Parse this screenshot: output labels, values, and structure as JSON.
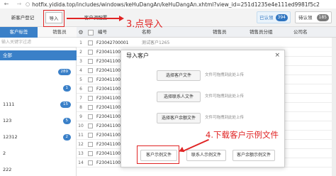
{
  "browser": {
    "back_icon": "arrow-left",
    "forward_icon": "arrow-right",
    "url": "hotfix.yididа.top/includes/windows/keHuDangAn/keHuDangAn.xhtml?view_id=251d1235e4e111ed9981f5c2"
  },
  "toolbar": {
    "new_customer_label": "新客户登记",
    "import_label": "导入",
    "import_config_label": "客户调配置",
    "filtered_label": "已认领",
    "filtered_count": "394",
    "todo_label": "待认领",
    "todo_count": "185"
  },
  "tabs": {
    "customer_tags": "客户标签",
    "sales": "销售员"
  },
  "left_panel": {
    "filter_placeholder": "输入关键字过滤",
    "items": [
      {
        "label": "全部",
        "count": ""
      },
      {
        "label": "",
        "count": "289"
      },
      {
        "label": "",
        "count": "1"
      },
      {
        "label": "1111",
        "count": "15"
      },
      {
        "label": "123",
        "count": "5"
      },
      {
        "label": "12312",
        "count": "2"
      },
      {
        "label": "2",
        "count": ""
      },
      {
        "label": "222",
        "count": ""
      }
    ]
  },
  "table": {
    "settings_icon": "gear",
    "columns": [
      "编号",
      "名称",
      "销售员",
      "销售员分组",
      "公司名"
    ],
    "rows": [
      {
        "num": "1",
        "no": "F23042700001",
        "name": "测试客户1265"
      },
      {
        "num": "2",
        "no": "F23041100001",
        "name": ""
      },
      {
        "num": "3",
        "no": "F23041100001",
        "name": ""
      },
      {
        "num": "4",
        "no": "F23041100001",
        "name": ""
      },
      {
        "num": "5",
        "no": "F23041100001",
        "name": ""
      },
      {
        "num": "6",
        "no": "F23041100001",
        "name": ""
      },
      {
        "num": "7",
        "no": "F23041100001",
        "name": ""
      },
      {
        "num": "8",
        "no": "F23041100001",
        "name": ""
      },
      {
        "num": "9",
        "no": "F23041100001",
        "name": ""
      },
      {
        "num": "10",
        "no": "F23041100001",
        "name": ""
      },
      {
        "num": "11",
        "no": "F23041100001",
        "name": ""
      },
      {
        "num": "12",
        "no": "F23041100001",
        "name": ""
      },
      {
        "num": "13",
        "no": "F23041100001",
        "name": ""
      },
      {
        "num": "14",
        "no": "F23041100001",
        "name": ""
      }
    ]
  },
  "modal": {
    "title": "导入客户",
    "close_icon": "×",
    "select_customer_label": "选择客户文件",
    "select_customer_hint": "文件可拖拽到此处上传",
    "select_contact_label": "选择联系人文件",
    "select_contact_hint": "文件可拖拽到此处上传",
    "select_balance_label": "选择客户余额文件",
    "select_balance_hint": "文件可拖拽到此处上传",
    "download_customer_label": "客户示例文件",
    "download_contact_label": "联系人示例文件",
    "download_balance_label": "客户余额示例文件"
  },
  "annotations": {
    "step3": "3.点导入",
    "step4": "4.下载客户示例文件",
    "color": "#e02424"
  }
}
